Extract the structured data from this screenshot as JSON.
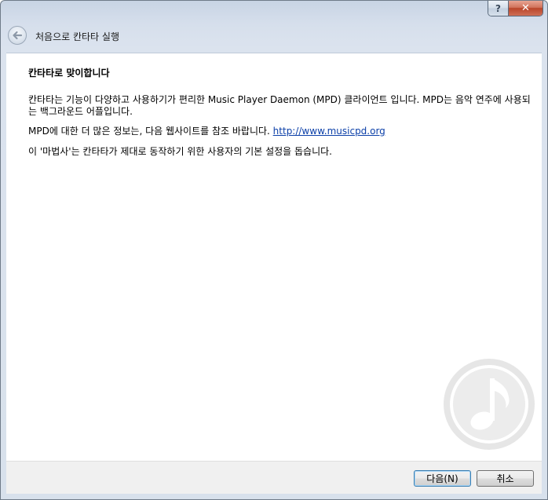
{
  "window": {
    "title": "처음으로 칸타타 실행",
    "help_label": "?",
    "close_label": "✕"
  },
  "icons": {
    "back": "back-arrow-icon",
    "watermark": "music-note-icon"
  },
  "page": {
    "heading": "칸타타로 맞이합니다",
    "paragraph1": "칸타타는 기능이 다양하고 사용하기가 편리한 Music Player Daemon (MPD) 클라이언트 입니다. MPD는 음악 연주에 사용되는 백그라운드 어플입니다.",
    "paragraph2_text": "MPD에 대한 더 많은 정보는, 다음 웹사이트를 참조 바랍니다. ",
    "paragraph2_link": "http://www.musicpd.org",
    "paragraph3": "이 '마법사'는 칸타타가 제대로 동작하기 위한 사용자의 기본 설정을 돕습니다."
  },
  "buttons": {
    "next": "다음(N)",
    "cancel": "취소"
  },
  "colors": {
    "link": "#0b3fa8",
    "close": "#c24a30",
    "frame": "#d8e1ec"
  }
}
